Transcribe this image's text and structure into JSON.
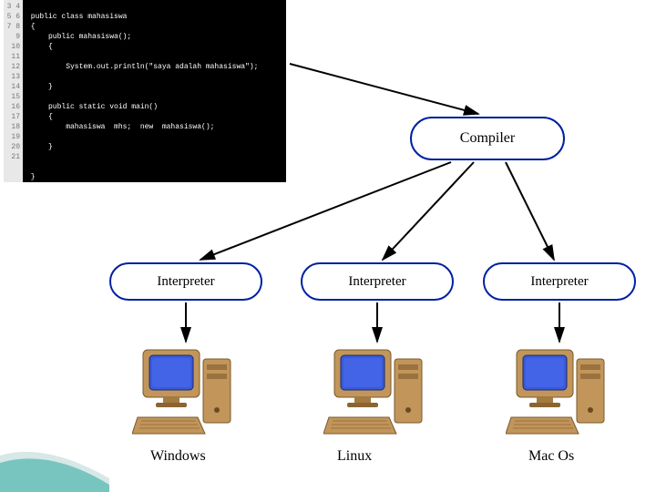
{
  "code": {
    "line_numbers": [
      "3",
      "4",
      "5",
      "6",
      "7",
      "8",
      "9",
      "10",
      "11",
      "12",
      "13",
      "14",
      "15",
      "16",
      "17",
      "18",
      "19",
      "20",
      "21"
    ],
    "lines": [
      "",
      " public class mahasiswa",
      " {",
      "     public mahasiswa();",
      "     {",
      "",
      "         System.out.println(\"saya adalah mahasiswa\");",
      "",
      "     }",
      "",
      "     public static void main()",
      "     {",
      "         mahasiswa  mhs;  new  mahasiswa();",
      "",
      "     }",
      "",
      "",
      " }",
      ""
    ]
  },
  "nodes": {
    "compiler": "Compiler",
    "interpreter1": "Interpreter",
    "interpreter2": "Interpreter",
    "interpreter3": "Interpreter"
  },
  "os": {
    "windows": "Windows",
    "linux": "Linux",
    "macos": "Mac Os"
  },
  "colors": {
    "node_border": "#0020a0",
    "monitor_screen": "#3a5bd8",
    "case": "#c2955a"
  }
}
